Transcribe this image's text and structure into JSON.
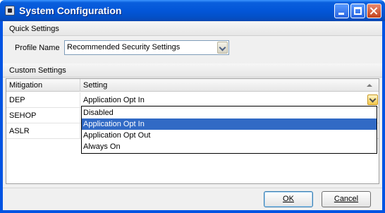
{
  "window": {
    "title": "System Configuration"
  },
  "quick_settings": {
    "header": "Quick Settings",
    "profile_label": "Profile Name",
    "profile_value": "Recommended Security Settings"
  },
  "custom_settings": {
    "header": "Custom Settings",
    "columns": [
      "Mitigation",
      "Setting"
    ],
    "rows": [
      {
        "mitigation": "DEP",
        "setting": "Application Opt In"
      },
      {
        "mitigation": "SEHOP",
        "setting": ""
      },
      {
        "mitigation": "ASLR",
        "setting": ""
      }
    ]
  },
  "setting_dropdown": {
    "options": [
      "Disabled",
      "Application Opt In",
      "Application Opt Out",
      "Always On"
    ],
    "highlighted": "Application Opt In"
  },
  "buttons": {
    "ok_label": "OK",
    "cancel_label": "Cancel"
  },
  "colors": {
    "titlebar": "#0054e3",
    "selection": "#316ac5"
  },
  "icons": [
    "app-icon",
    "minimize-icon",
    "maximize-icon",
    "close-icon",
    "chevron-down-icon",
    "sort-ascending-icon"
  ]
}
